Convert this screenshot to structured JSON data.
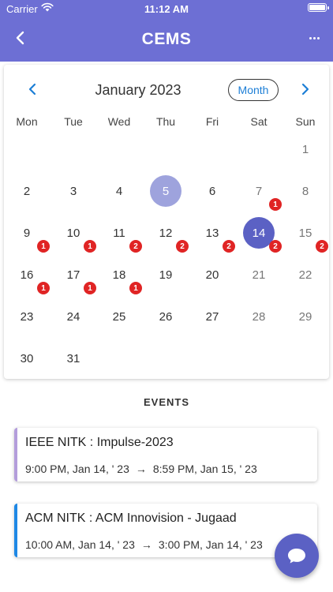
{
  "status_bar": {
    "carrier": "Carrier",
    "time": "11:12 AM"
  },
  "app_bar": {
    "title": "CEMS",
    "back_icon": "chevron-left-icon",
    "more_icon": "more-horizontal-icon"
  },
  "calendar": {
    "month_label": "January 2023",
    "format_button": "Month",
    "weekdays": [
      "Mon",
      "Tue",
      "Wed",
      "Thu",
      "Fri",
      "Sat",
      "Sun"
    ],
    "weeks": [
      [
        null,
        null,
        null,
        null,
        null,
        null,
        1
      ],
      [
        2,
        3,
        4,
        5,
        6,
        7,
        8
      ],
      [
        9,
        10,
        11,
        12,
        13,
        14,
        15
      ],
      [
        16,
        17,
        18,
        19,
        20,
        21,
        22
      ],
      [
        23,
        24,
        25,
        26,
        27,
        28,
        29
      ],
      [
        30,
        31,
        null,
        null,
        null,
        null,
        null
      ]
    ],
    "today": 5,
    "selected": 14,
    "event_counts": {
      "7": 1,
      "9": 1,
      "10": 1,
      "11": 2,
      "12": 2,
      "13": 2,
      "14": 2,
      "15": 2,
      "16": 1,
      "17": 1,
      "18": 1
    },
    "colors": {
      "today": "#9ea3dd",
      "selected": "#5b61c4",
      "badge": "#e02424",
      "nav": "#1c7ed6"
    }
  },
  "events_heading": "EVENTS",
  "events": [
    {
      "title": "IEEE NITK : Impulse-2023",
      "start": "9:00 PM, Jan 14, ' 23",
      "arrow": "→",
      "end": "8:59 PM, Jan 15, ' 23",
      "accent": "#b39ddb"
    },
    {
      "title": "ACM NITK : ACM Innovision - Jugaad",
      "start": "10:00 AM, Jan 14, ' 23",
      "arrow": "→",
      "end": "3:00 PM, Jan 14, ' 23",
      "accent": "#1e88e5"
    }
  ],
  "fab": {
    "icon": "chat-bubble-icon",
    "color": "#5b61c4"
  },
  "app_bar_color": "#6d6fd4"
}
